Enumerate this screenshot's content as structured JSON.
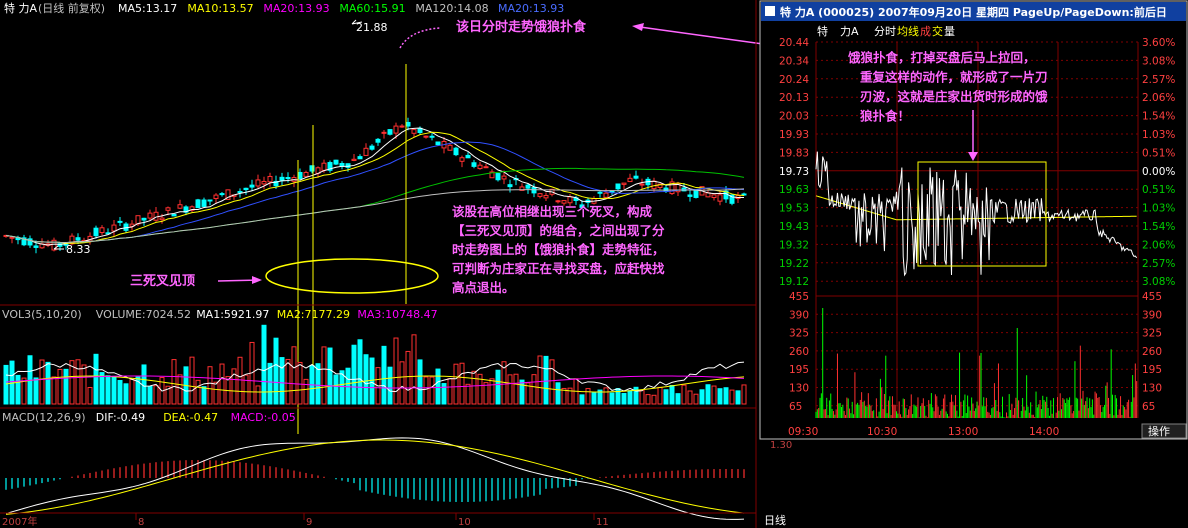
{
  "stock": {
    "name": "特 力A",
    "mode": "(日线 前复权)"
  },
  "ma_legend": [
    {
      "label": "MA5:13.17",
      "color": "#ffffff"
    },
    {
      "label": "MA10:13.57",
      "color": "#ffff00"
    },
    {
      "label": "MA20:13.93",
      "color": "#ff00ff"
    },
    {
      "label": "MA60:15.91",
      "color": "#00ff00"
    },
    {
      "label": "MA120:14.08",
      "color": "#c0c0c0"
    },
    {
      "label": "MA20:13.93",
      "color": "#4a6cff"
    }
  ],
  "annotations": {
    "high_price": "21.88",
    "low_price": "8.33",
    "intraday_note": "该日分时走势饿狼扑食",
    "three_death_label": "三死叉见顶",
    "analysis_lines": [
      "该股在高位相继出现三个死叉，构成",
      "【三死叉见顶】的组合，之间出现了分",
      "时走势图上的【饿狼扑食】走势特征，",
      "可判断为庄家正在寻找买盘，应赶快找",
      "高点退出。"
    ],
    "hungry_wolf_lines": [
      "饿狼扑食，打掉买盘后马上拉回，",
      "重复这样的动作，就形成了一片刀",
      "刃波，这就是庄家出货时形成的饿",
      "狼扑食！"
    ]
  },
  "volume_legend": [
    {
      "label": "VOL3(5,10,20)",
      "color": "#c0c0c0"
    },
    {
      "label": "VOLUME:7024.52",
      "color": "#c0c0c0"
    },
    {
      "label": "MA1:5921.97",
      "color": "#ffffff"
    },
    {
      "label": "MA2:7177.29",
      "color": "#ffff00"
    },
    {
      "label": "MA3:10748.47",
      "color": "#ff00ff"
    }
  ],
  "macd_legend": [
    {
      "label": "MACD(12,26,9)",
      "color": "#c0c0c0"
    },
    {
      "label": "DIF:-0.49",
      "color": "#ffffff"
    },
    {
      "label": "DEA:-0.47",
      "color": "#ffff00"
    },
    {
      "label": "MACD:-0.05",
      "color": "#ff00ff"
    }
  ],
  "macd_axis": "1.30",
  "date_axis": {
    "year": "2007年",
    "months": [
      "8",
      "9",
      "10",
      "11"
    ]
  },
  "bottom_tab": "日线",
  "intraday": {
    "title": "特 力A (000025) 2007年09月20日 星期四 PageUp/PageDown:前后日",
    "tabs": [
      {
        "label": "特",
        "color": "#ffffff"
      },
      {
        "label": "力A",
        "color": "#ffffff"
      },
      {
        "label": "分时",
        "color": "#ffffff"
      },
      {
        "label": "均线",
        "color": "#ffff00"
      },
      {
        "label": "成",
        "color": "#ff4040"
      },
      {
        "label": "交",
        "color": "#ffff00"
      },
      {
        "label": "量",
        "color": "#ffffff"
      }
    ],
    "price_labels": [
      "20.44",
      "20.34",
      "20.24",
      "20.13",
      "20.03",
      "19.93",
      "19.83",
      "19.73",
      "19.63",
      "19.53",
      "19.43",
      "19.32",
      "19.22",
      "19.12"
    ],
    "pct_labels": [
      "3.60%",
      "3.08%",
      "2.57%",
      "2.06%",
      "1.54%",
      "1.03%",
      "0.51%",
      "0.00%",
      "0.51%",
      "1.03%",
      "1.54%",
      "2.06%",
      "2.57%",
      "3.08%"
    ],
    "vol_labels": [
      "455",
      "390",
      "325",
      "260",
      "195",
      "130",
      "65"
    ],
    "time_labels": [
      "09:30",
      "10:30",
      "13:00",
      "14:00"
    ],
    "operate_btn": "操作"
  }
}
